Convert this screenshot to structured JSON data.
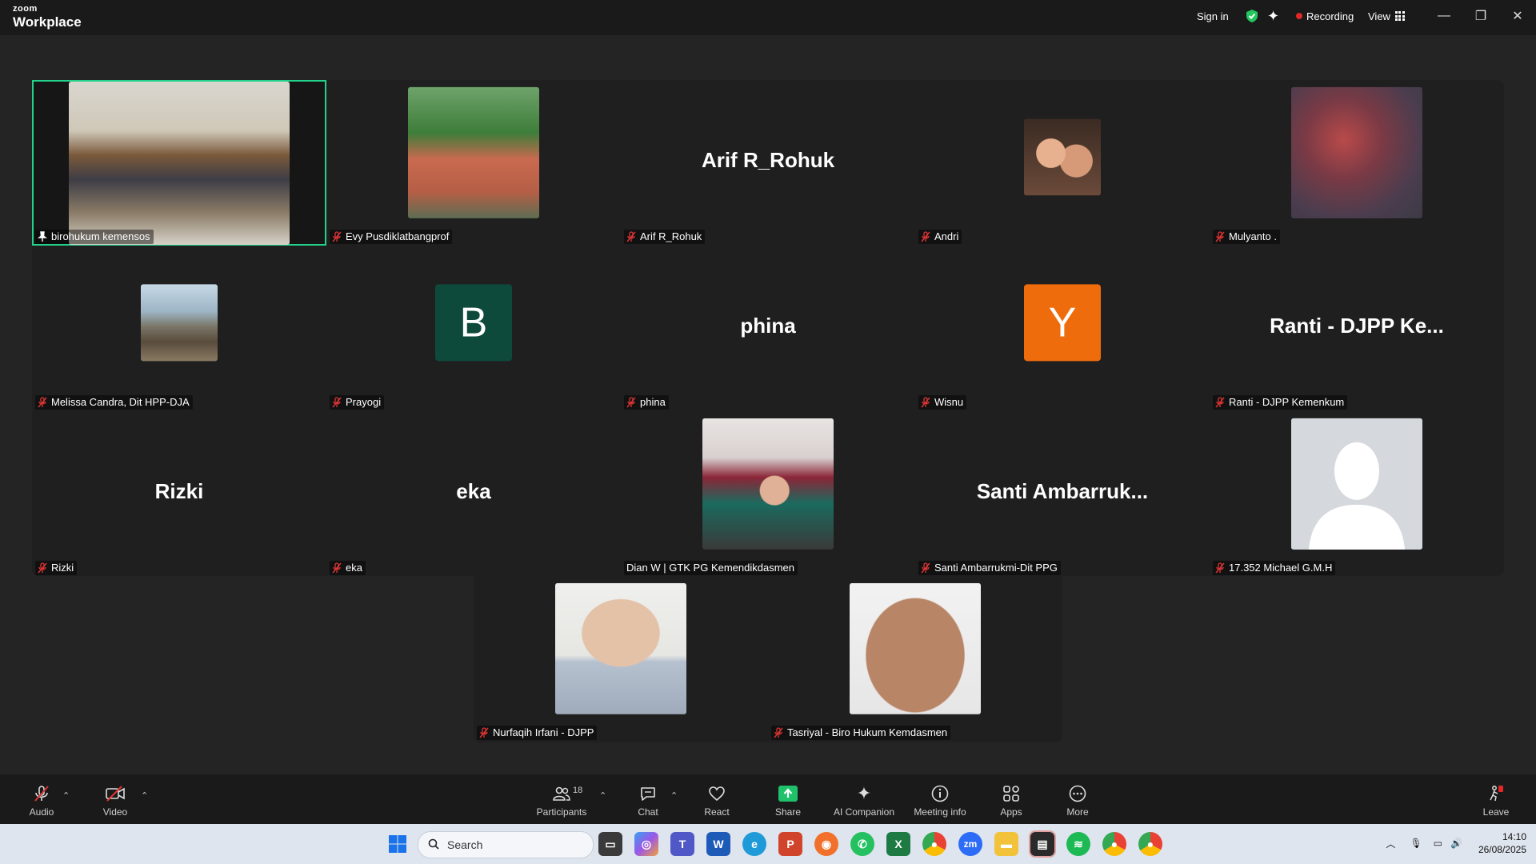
{
  "titlebar": {
    "brand_top": "zoom",
    "brand_bottom": "Workplace",
    "sign_in": "Sign in",
    "recording": "Recording",
    "view": "View",
    "colors": {
      "recording_dot": "#e02828",
      "shield": "#23c55e",
      "active_outline": "#23d18b"
    }
  },
  "participants": [
    {
      "name": "birohukum kemensos",
      "display": "video",
      "pinned": true
    },
    {
      "name": "Evy Pusdiklatbangprof",
      "display": "video"
    },
    {
      "name": "Arif R_Rohuk",
      "display": "name",
      "big": "Arif R_Rohuk"
    },
    {
      "name": "Andri",
      "display": "photo"
    },
    {
      "name": "Mulyanto .",
      "display": "photo"
    },
    {
      "name": "Melissa Candra, Dit HPP-DJA",
      "display": "photo"
    },
    {
      "name": "Prayogi",
      "display": "initial",
      "initial": "B",
      "color": "#0d4a3c"
    },
    {
      "name": "phina",
      "display": "name",
      "big": "phina"
    },
    {
      "name": "Wisnu",
      "display": "initial",
      "initial": "Y",
      "color": "#ef6c0c"
    },
    {
      "name": "Ranti - DJPP Kemenkum",
      "display": "name",
      "big": "Ranti - DJPP Ke..."
    },
    {
      "name": "Rizki",
      "display": "name",
      "big": "Rizki"
    },
    {
      "name": "eka",
      "display": "name",
      "big": "eka"
    },
    {
      "name": "Dian W | GTK PG Kemendikdasmen",
      "display": "photo"
    },
    {
      "name": "Santi Ambarrukmi-Dit PPG",
      "display": "name",
      "big": "Santi Ambarruk..."
    },
    {
      "name": "17.352 Michael G.M.H",
      "display": "avatar"
    },
    {
      "name": "Nurfaqih Irfani - DJPP",
      "display": "photo"
    },
    {
      "name": "Tasriyal - Biro Hukum Kemdasmen",
      "display": "photo"
    }
  ],
  "toolbar": {
    "audio": "Audio",
    "video": "Video",
    "participants": "Participants",
    "participants_count": "18",
    "chat": "Chat",
    "react": "React",
    "share": "Share",
    "ai_companion": "AI Companion",
    "meeting_info": "Meeting info",
    "apps": "Apps",
    "more": "More",
    "leave": "Leave",
    "colors": {
      "share": "#1fc16b",
      "leave": "#e02828"
    }
  },
  "taskbar": {
    "search_placeholder": "Search",
    "time": "14:10",
    "date": "26/08/2025"
  }
}
